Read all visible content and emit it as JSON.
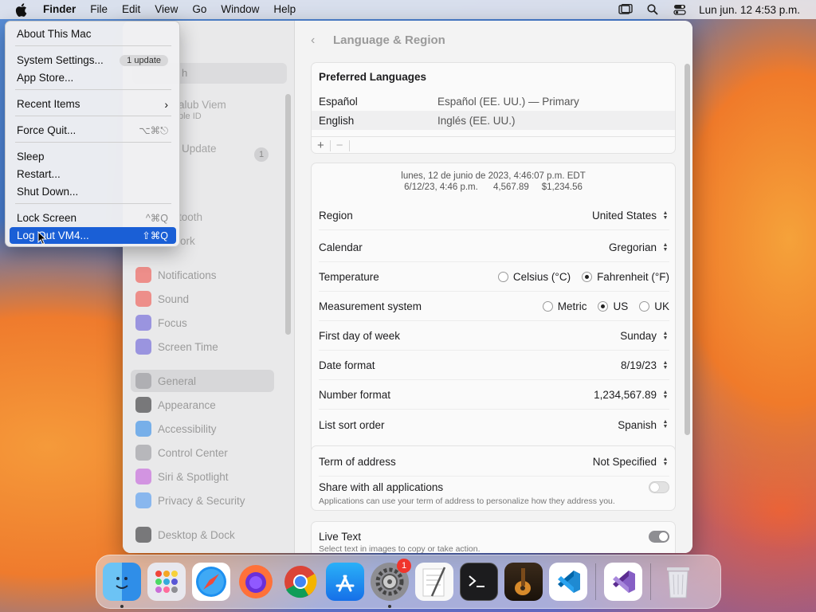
{
  "menubar": {
    "app": "Finder",
    "items": [
      "File",
      "Edit",
      "View",
      "Go",
      "Window",
      "Help"
    ],
    "clock": "Lun jun. 12  4:53 p.m."
  },
  "apple_menu": {
    "about": "About This Mac",
    "system_settings": "System Settings...",
    "update_badge": "1 update",
    "app_store": "App Store...",
    "recent_items": "Recent Items",
    "force_quit": "Force Quit...",
    "force_quit_shortcut": "⌥⌘⎋",
    "sleep": "Sleep",
    "restart": "Restart...",
    "shut_down": "Shut Down...",
    "lock_screen": "Lock Screen",
    "lock_screen_shortcut": "^⌘Q",
    "log_out": "Log Out VM4...",
    "log_out_shortcut": "⇧⌘Q"
  },
  "sidebar": {
    "search_partial": "h",
    "user_partial": "alub Viem",
    "user_sub_partial": "ple ID",
    "update_partial": "Update",
    "update_count": "1",
    "bluetooth_partial": "tooth",
    "network_partial": "ork",
    "items": [
      {
        "label": "Notifications",
        "color": "#f0443a"
      },
      {
        "label": "Sound",
        "color": "#f0443a"
      },
      {
        "label": "Focus",
        "color": "#5a4fd6"
      },
      {
        "label": "Screen Time",
        "color": "#5a4fd6"
      },
      {
        "label": "General",
        "color": "#8e8e93"
      },
      {
        "label": "Appearance",
        "color": "#1c1c1e"
      },
      {
        "label": "Accessibility",
        "color": "#1a7fe8"
      },
      {
        "label": "Control Center",
        "color": "#8e8e93"
      },
      {
        "label": "Siri & Spotlight",
        "color": "#c04fd8"
      },
      {
        "label": "Privacy & Security",
        "color": "#3a8ef0"
      },
      {
        "label": "Desktop & Dock",
        "color": "#1c1c1e"
      }
    ]
  },
  "content": {
    "title": "Language & Region",
    "preferred_languages": {
      "heading": "Preferred Languages",
      "rows": [
        {
          "name": "Español",
          "desc": "Español (EE. UU.) — Primary"
        },
        {
          "name": "English",
          "desc": "Inglés (EE. UU.)"
        }
      ],
      "add": "+",
      "remove": "−"
    },
    "sample_line1": "lunes, 12 de junio de 2023, 4:46:07 p.m. EDT",
    "sample_line2": "6/12/23, 4:46 p.m.      4,567.89     $1,234.56",
    "region": {
      "label": "Region",
      "value": "United States"
    },
    "calendar": {
      "label": "Calendar",
      "value": "Gregorian"
    },
    "temperature": {
      "label": "Temperature",
      "opt1": "Celsius (°C)",
      "opt2": "Fahrenheit (°F)"
    },
    "measurement": {
      "label": "Measurement system",
      "opt1": "Metric",
      "opt2": "US",
      "opt3": "UK"
    },
    "first_day": {
      "label": "First day of week",
      "value": "Sunday"
    },
    "date_format": {
      "label": "Date format",
      "value": "8/19/23"
    },
    "number_format": {
      "label": "Number format",
      "value": "1,234,567.89"
    },
    "sort_order": {
      "label": "List sort order",
      "value": "Spanish"
    },
    "term_of_address": {
      "label": "Term of address",
      "value": "Not Specified"
    },
    "share": {
      "label": "Share with all applications",
      "sub": "Applications can use your term of address to personalize how they address you."
    },
    "live_text": {
      "label": "Live Text",
      "sub": "Select text in images to copy or take action."
    }
  },
  "dock": {
    "settings_badge": "1"
  }
}
